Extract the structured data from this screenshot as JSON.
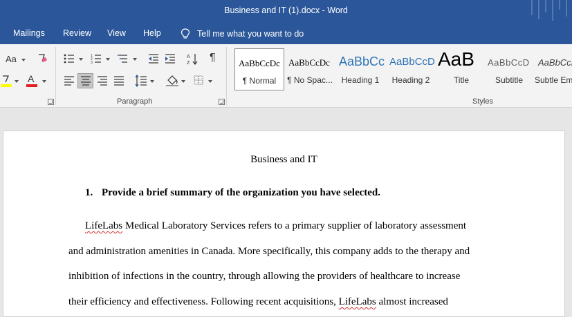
{
  "window": {
    "title": "Business and IT (1).docx  -  Word"
  },
  "tabs": [
    {
      "label": "Mailings"
    },
    {
      "label": "Review"
    },
    {
      "label": "View"
    },
    {
      "label": "Help"
    }
  ],
  "tell_me": {
    "label": "Tell me what you want to do",
    "icon": "lightbulb-icon"
  },
  "ribbon": {
    "font_partial": {
      "change_case_label": "Aa",
      "highlight_color": "#ffff00",
      "font_color": "#e02020"
    },
    "paragraph_group_label": "Paragraph",
    "styles_group_label": "Styles",
    "styles": [
      {
        "sample": "AaBbCcDc",
        "name": "¶ Normal"
      },
      {
        "sample": "AaBbCcDc",
        "name": "¶ No Spac..."
      },
      {
        "sample": "AaBbCc",
        "name": "Heading 1"
      },
      {
        "sample": "AaBbCcD",
        "name": "Heading 2"
      },
      {
        "sample": "AaB",
        "name": "Title"
      },
      {
        "sample": "AaBbCcD",
        "name": "Subtitle"
      },
      {
        "sample": "AaBbCcDi",
        "name": "Subtle Em..."
      }
    ]
  },
  "document": {
    "title": "Business and IT",
    "heading_number": "1.",
    "heading_text": "Provide a brief summary of the organization you have selected.",
    "lines": [
      {
        "pre": "",
        "flag": "LifeLabs",
        "post": " Medical Laboratory Services refers to a primary supplier of laboratory assessment"
      },
      {
        "pre": "and administration amenities in Canada. More specifically, this company adds to the therapy and",
        "flag": "",
        "post": ""
      },
      {
        "pre": "inhibition of infections in the country, through allowing the providers of healthcare to increase",
        "flag": "",
        "post": ""
      },
      {
        "pre": "their efficiency and effectiveness. Following recent acquisitions, ",
        "flag": "LifeLabs",
        "post": " almost increased"
      }
    ]
  }
}
